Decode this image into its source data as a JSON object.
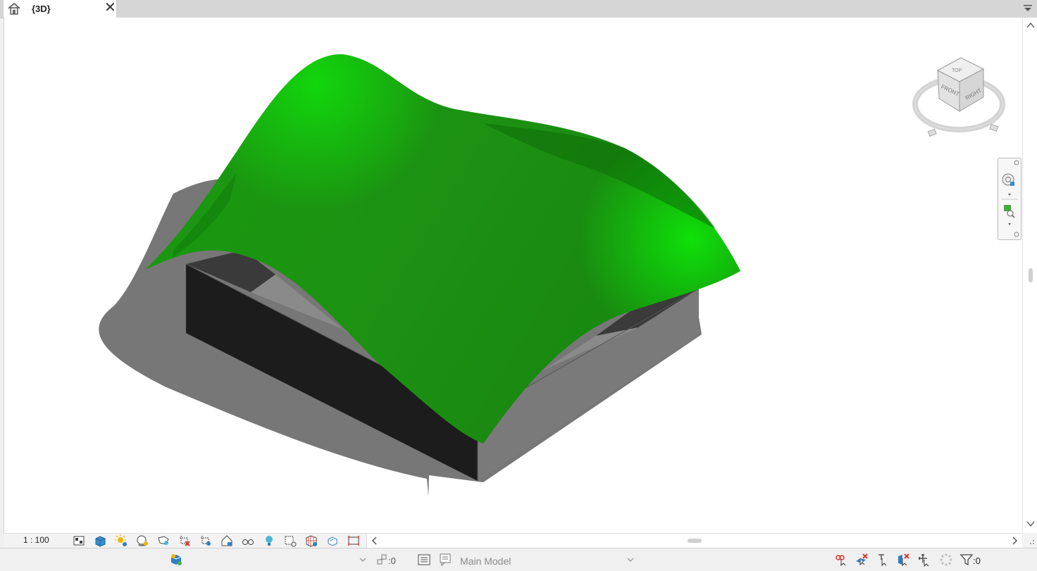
{
  "tab": {
    "title": "{3D}",
    "close_glyph": "✕",
    "icon": "home-icon"
  },
  "viewport": {
    "scene": "3d-model",
    "colors": {
      "roof": "#1f9e12",
      "box": "#1c1c1c",
      "shadow": "#777777"
    },
    "viewcube": {
      "top": "TOP",
      "front": "FRONT",
      "right": "RIGHT"
    }
  },
  "view_control_bar": {
    "scale": "1 : 100",
    "icons": [
      "detail-level-icon",
      "visual-style-icon",
      "sun-path-icon",
      "shadows-icon",
      "render-icon",
      "crop-view-icon",
      "show-crop-icon",
      "lock-view-icon",
      "temporary-hide-icon",
      "reveal-hidden-icon",
      "temporary-view-properties-icon",
      "show-analytical-model-icon",
      "highlight-displacement-icon",
      "reveal-constraints-icon"
    ]
  },
  "status_bar": {
    "worksets_count": ":0",
    "active_model": "Main Model",
    "filter_count": ":0",
    "colors": {
      "accent_red": "#d9372b",
      "accent_blue": "#2f7fc1"
    }
  }
}
